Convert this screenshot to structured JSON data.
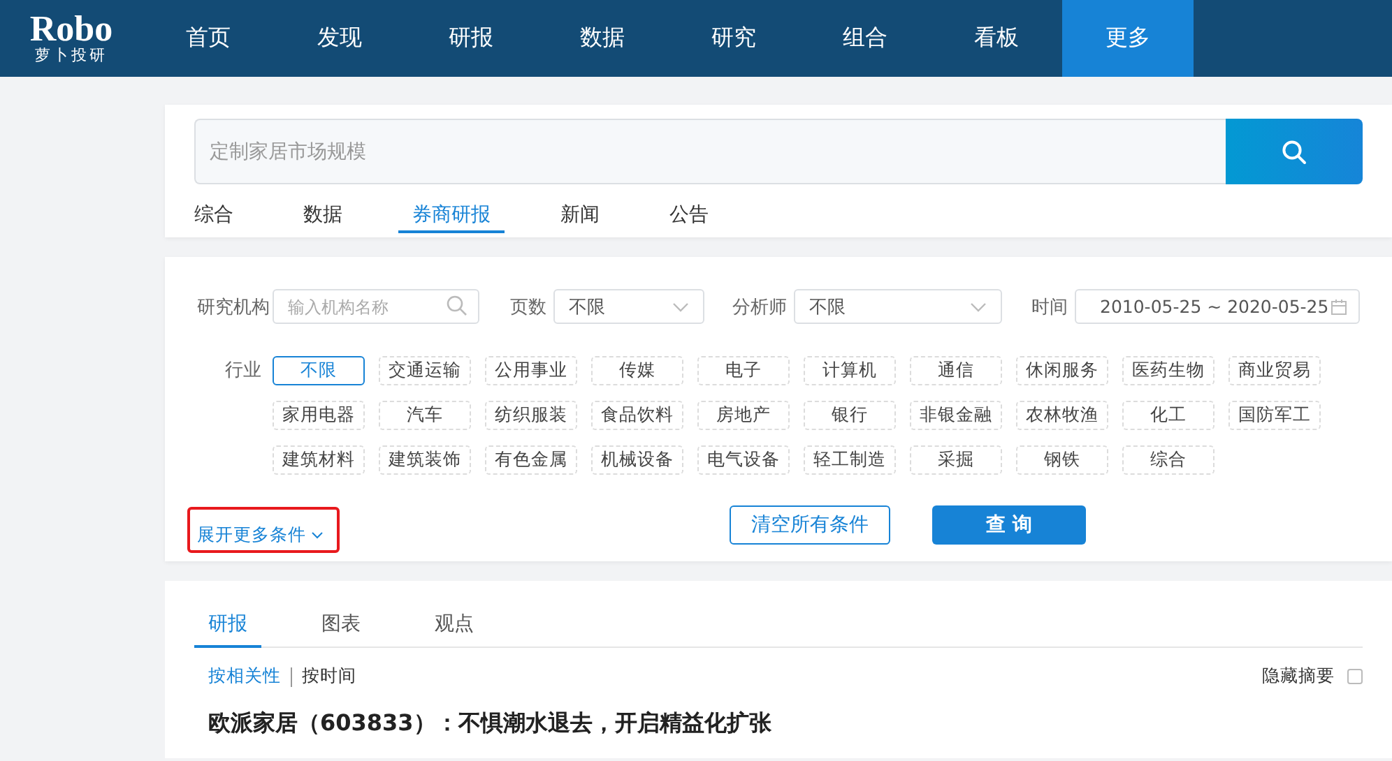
{
  "logo": {
    "name": "Robo",
    "subtitle": "萝卜投研"
  },
  "nav": [
    {
      "label": "首页",
      "selected": false
    },
    {
      "label": "发现",
      "selected": false
    },
    {
      "label": "研报",
      "selected": false
    },
    {
      "label": "数据",
      "selected": false
    },
    {
      "label": "研究",
      "selected": false
    },
    {
      "label": "组合",
      "selected": false
    },
    {
      "label": "看板",
      "selected": false
    },
    {
      "label": "更多",
      "selected": true
    }
  ],
  "search": {
    "placeholder": "定制家居市场规模"
  },
  "search_tabs": [
    {
      "label": "综合",
      "selected": false
    },
    {
      "label": "数据",
      "selected": false
    },
    {
      "label": "券商研报",
      "selected": true
    },
    {
      "label": "新闻",
      "selected": false
    },
    {
      "label": "公告",
      "selected": false
    }
  ],
  "filters": {
    "institution": {
      "label": "研究机构",
      "placeholder": "输入机构名称"
    },
    "pages": {
      "label": "页数",
      "value": "不限"
    },
    "analyst": {
      "label": "分析师",
      "value": "不限"
    },
    "time": {
      "label": "时间",
      "start": "2010-05-25",
      "separator": "~",
      "end": "2020-05-25"
    }
  },
  "industry": {
    "label": "行业",
    "options": [
      {
        "label": "不限",
        "selected": true
      },
      {
        "label": "交通运输",
        "selected": false
      },
      {
        "label": "公用事业",
        "selected": false
      },
      {
        "label": "传媒",
        "selected": false
      },
      {
        "label": "电子",
        "selected": false
      },
      {
        "label": "计算机",
        "selected": false
      },
      {
        "label": "通信",
        "selected": false
      },
      {
        "label": "休闲服务",
        "selected": false
      },
      {
        "label": "医药生物",
        "selected": false
      },
      {
        "label": "商业贸易",
        "selected": false
      },
      {
        "label": "家用电器",
        "selected": false
      },
      {
        "label": "汽车",
        "selected": false
      },
      {
        "label": "纺织服装",
        "selected": false
      },
      {
        "label": "食品饮料",
        "selected": false
      },
      {
        "label": "房地产",
        "selected": false
      },
      {
        "label": "银行",
        "selected": false
      },
      {
        "label": "非银金融",
        "selected": false
      },
      {
        "label": "农林牧渔",
        "selected": false
      },
      {
        "label": "化工",
        "selected": false
      },
      {
        "label": "国防军工",
        "selected": false
      },
      {
        "label": "建筑材料",
        "selected": false
      },
      {
        "label": "建筑装饰",
        "selected": false
      },
      {
        "label": "有色金属",
        "selected": false
      },
      {
        "label": "机械设备",
        "selected": false
      },
      {
        "label": "电气设备",
        "selected": false
      },
      {
        "label": "轻工制造",
        "selected": false
      },
      {
        "label": "采掘",
        "selected": false
      },
      {
        "label": "钢铁",
        "selected": false
      },
      {
        "label": "综合",
        "selected": false
      }
    ]
  },
  "expand_link": {
    "label": "展开更多条件",
    "highlighted": true
  },
  "buttons": {
    "clear": "清空所有条件",
    "query": "查 询"
  },
  "results": {
    "tabs": [
      {
        "label": "研报",
        "selected": true
      },
      {
        "label": "图表",
        "selected": false
      },
      {
        "label": "观点",
        "selected": false
      }
    ],
    "sort": [
      {
        "label": "按相关性",
        "selected": true
      },
      {
        "label": "按时间",
        "selected": false
      }
    ],
    "hide_summary": {
      "label": "隐藏摘要",
      "checked": false
    },
    "items": [
      {
        "title": "欧派家居（603833）：不惧潮水退去，开启精益化扩张"
      }
    ]
  }
}
